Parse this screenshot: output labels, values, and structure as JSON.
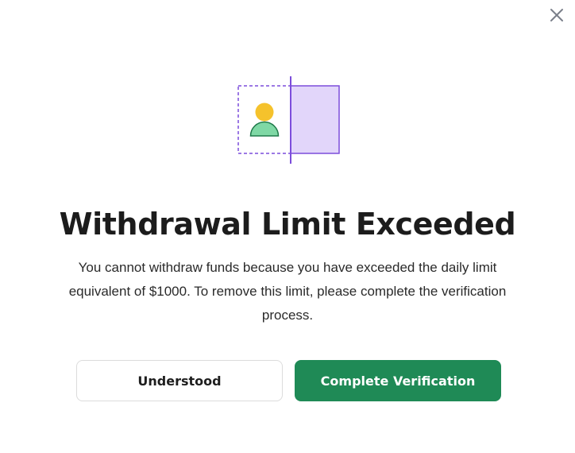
{
  "modal": {
    "title": "Withdrawal Limit Exceeded",
    "description": "You cannot withdraw funds because you have exceeded the daily limit equivalent of $1000. To remove this limit, please complete the verification process.",
    "close_icon": "close-icon",
    "illustration_icon": "user-verification-illustration",
    "buttons": {
      "secondary_label": "Understood",
      "primary_label": "Complete Verification"
    }
  },
  "colors": {
    "primary": "#1f8a56",
    "accent_purple": "#7c4ddb",
    "purple_fill": "#e2d6fa",
    "avatar_head": "#f5c22c",
    "avatar_body": "#7fd8a5"
  }
}
